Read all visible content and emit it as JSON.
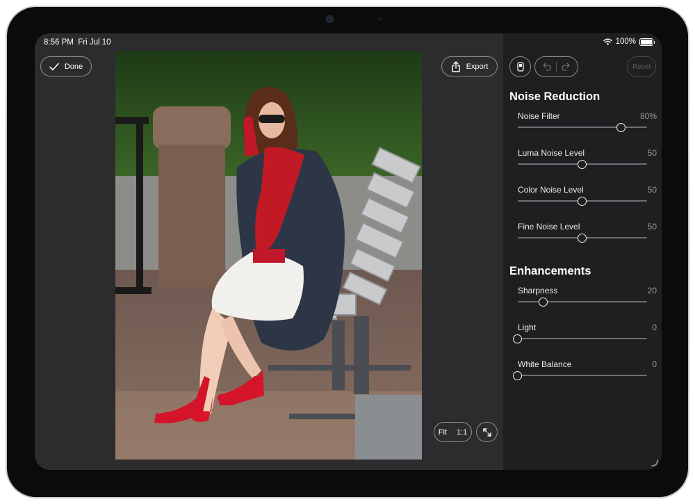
{
  "status_bar": {
    "time": "8:56 PM",
    "date": "Fri Jul 10",
    "battery": "100%"
  },
  "toolbar": {
    "done_label": "Done",
    "export_label": "Export",
    "reset_label": "Reset"
  },
  "view_controls": {
    "fit_label": "Fit",
    "one_to_one_label": "1:1"
  },
  "noise_reduction": {
    "title": "Noise Reduction",
    "sliders": [
      {
        "label": "Noise Filter",
        "value": "80%",
        "fraction": 0.8
      },
      {
        "label": "Luma Noise Level",
        "value": "50",
        "fraction": 0.5
      },
      {
        "label": "Color Noise Level",
        "value": "50",
        "fraction": 0.5
      },
      {
        "label": "Fine Noise Level",
        "value": "50",
        "fraction": 0.5
      }
    ]
  },
  "enhancements": {
    "title": "Enhancements",
    "sliders": [
      {
        "label": "Sharpness",
        "value": "20",
        "fraction": 0.2
      },
      {
        "label": "Light",
        "value": "0",
        "fraction": 0.0
      },
      {
        "label": "White Balance",
        "value": "0",
        "fraction": 0.0
      }
    ]
  },
  "icons": {
    "done": "checkmark-icon",
    "export": "share-icon",
    "mask": "mask-icon",
    "undo": "undo-icon",
    "redo": "redo-icon",
    "expand": "expand-arrows-icon",
    "wifi": "wifi-icon",
    "battery": "battery-icon"
  },
  "colors": {
    "background": "#2c2c2e",
    "sidebar": "#1f1f21",
    "text": "#ffffff",
    "muted": "#9a9a9e"
  }
}
